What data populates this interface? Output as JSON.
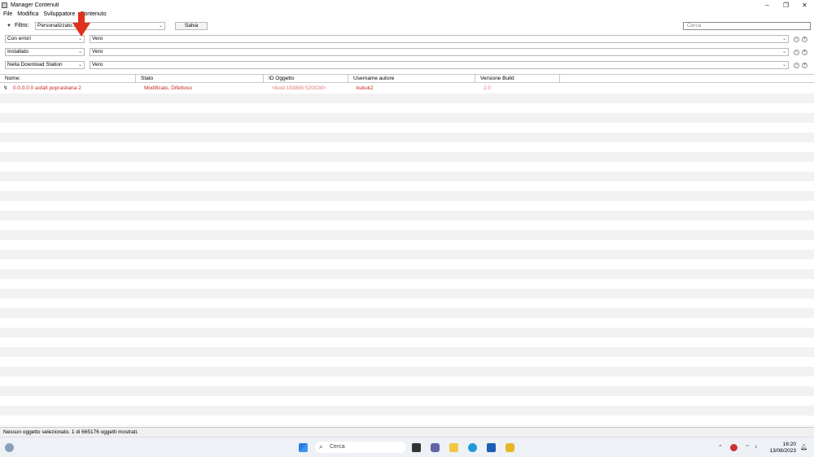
{
  "window": {
    "title": "Manager Contenuti",
    "minimize": "–",
    "maximize": "❐",
    "close": "✕"
  },
  "menu": [
    "File",
    "Modifica",
    "Sviluppatore",
    "Contenuto"
  ],
  "filter": {
    "label": "Filtro:",
    "preset": "Personalizzato...",
    "save": "Salva",
    "search_placeholder": "Cerca"
  },
  "conditions": [
    {
      "field": "Con errori",
      "value": "Vero"
    },
    {
      "field": "Installato",
      "value": "Vero"
    },
    {
      "field": "Nella Download Station",
      "value": "Vero"
    }
  ],
  "table": {
    "columns": [
      "Nome:",
      "Stato",
      "ID Oggetto",
      "Username autore",
      "Versione Build"
    ],
    "rows": [
      {
        "name": "0.0.0.0.0 asfalt popraskana 2",
        "status": "Modificato, Difettoso",
        "id": "<kuid:193885:520028>",
        "author": "kukuk2",
        "build": "2.0"
      }
    ]
  },
  "status_text": "Nessun oggetto selezionato. 1 di 665176 oggetti mostrati.",
  "taskbar": {
    "search": "Cerca",
    "time": "16:20",
    "date": "13/08/2023"
  },
  "colors": {
    "error_text": "#c8281e",
    "accent": "#e0301e"
  }
}
